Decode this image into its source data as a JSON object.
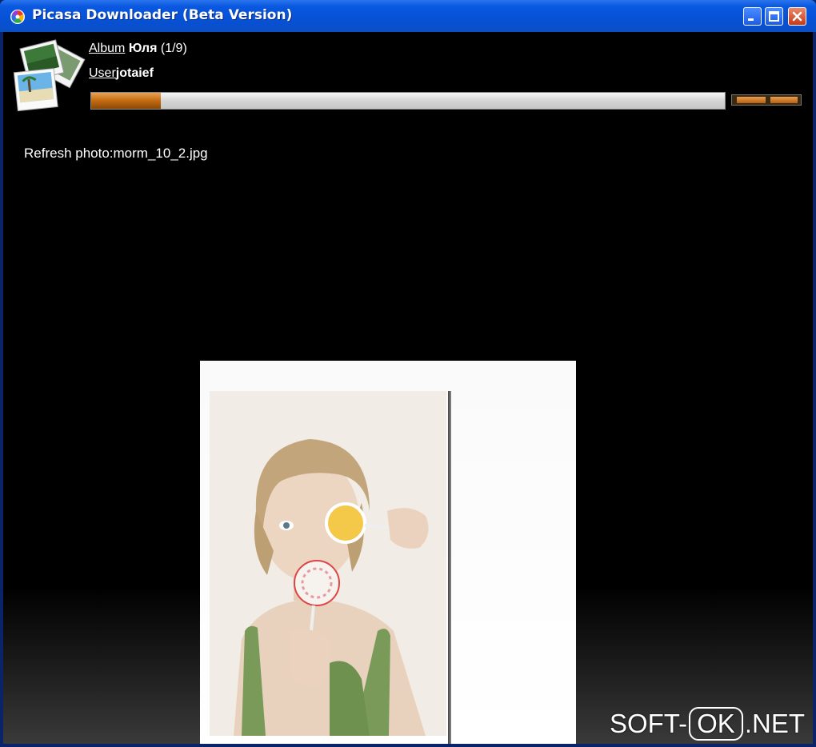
{
  "window": {
    "title": "Picasa Downloader (Beta Version)"
  },
  "header": {
    "album_label": "Album",
    "album_name": "Юля",
    "album_progress": "(1/9)",
    "user_label": "User",
    "user_name": "jotaief"
  },
  "progress": {
    "main_fraction": 0.11,
    "accent_color": "#c36a10"
  },
  "status": {
    "text": "Refresh photo:morm_10_2.jpg"
  },
  "watermark": {
    "prefix": "SOFT-",
    "middle": "OK",
    "suffix": ".NET"
  },
  "icons": {
    "app": "picasa-pinwheel-icon",
    "album": "photo-stack-icon",
    "minimize": "minimize-icon",
    "maximize": "maximize-icon",
    "close": "close-icon"
  }
}
